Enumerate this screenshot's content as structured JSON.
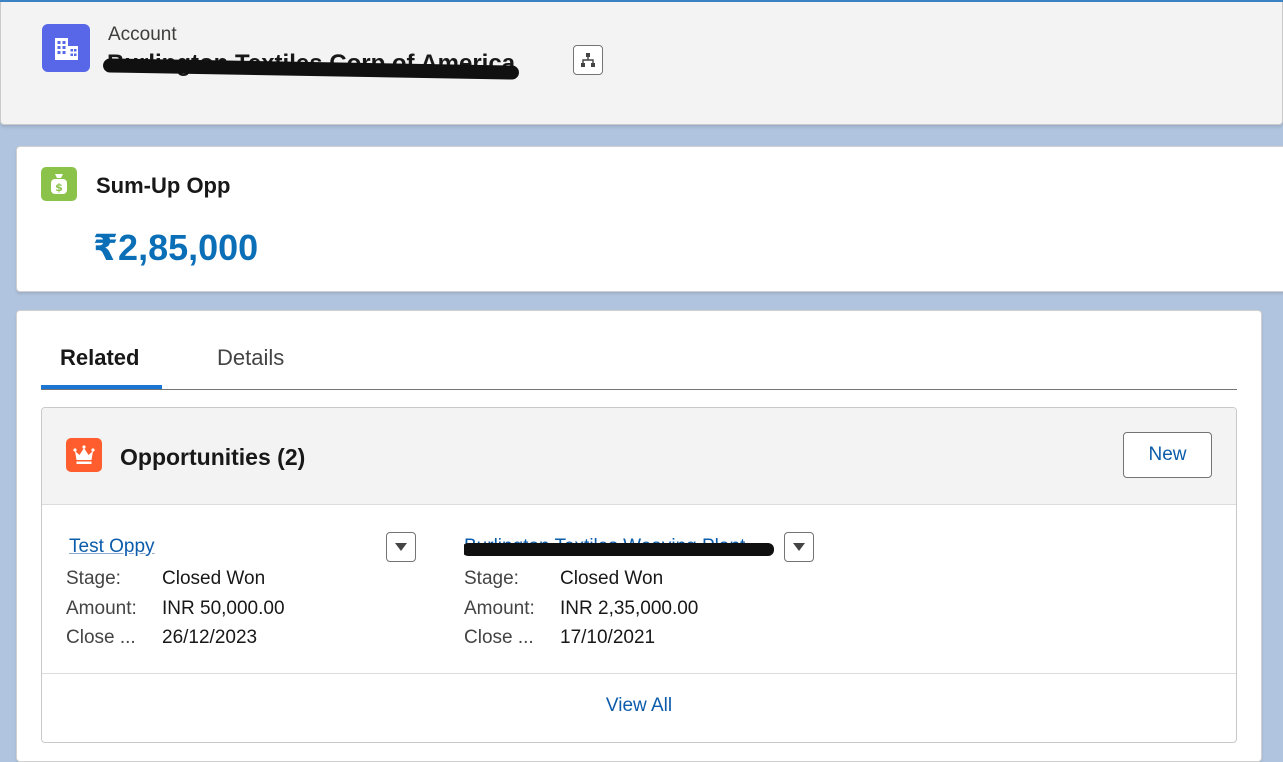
{
  "header": {
    "object_label": "Account",
    "account_name": "Burlington Textiles Corp of America",
    "icon": "building-icon",
    "hierarchy_icon": "hierarchy-icon"
  },
  "summary": {
    "title": "Sum-Up Opp",
    "value": "₹2,85,000",
    "icon": "money-bag-icon",
    "icon_color": "#8bc34a",
    "value_color": "#0b6fb8"
  },
  "tabs": [
    {
      "label": "Related",
      "active": true
    },
    {
      "label": "Details",
      "active": false
    }
  ],
  "opportunities": {
    "title": "Opportunities (2)",
    "icon": "crown-icon",
    "icon_color": "#ff5d2d",
    "new_label": "New",
    "view_all_label": "View All",
    "records": [
      {
        "name": "Test Oppy",
        "fields": [
          {
            "label": "Stage:",
            "value": "Closed Won"
          },
          {
            "label": "Amount:",
            "value": "INR 50,000.00"
          },
          {
            "label": "Close ...",
            "value": "26/12/2023"
          }
        ]
      },
      {
        "name": "Burlington Textiles Weaving Plant ...",
        "fields": [
          {
            "label": "Stage:",
            "value": "Closed Won"
          },
          {
            "label": "Amount:",
            "value": "INR 2,35,000.00"
          },
          {
            "label": "Close ...",
            "value": "17/10/2021"
          }
        ]
      }
    ]
  },
  "colors": {
    "page_background": "#b0c4df",
    "account_icon": "#5867e8",
    "link": "#0b5cab",
    "tab_active_underline": "#1b76d3"
  }
}
